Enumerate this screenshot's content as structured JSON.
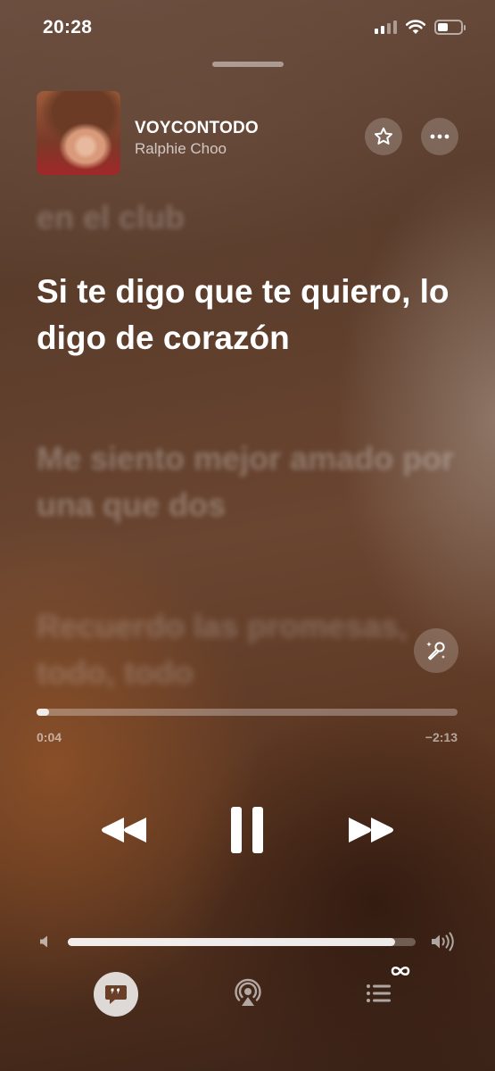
{
  "status_bar": {
    "time": "20:28",
    "icons": [
      "cellular-signal-icon",
      "wifi-icon",
      "battery-icon"
    ]
  },
  "now_playing": {
    "title": "VOYCONTODO",
    "artist": "Ralphie Choo",
    "favorite_icon": "star-icon",
    "more_icon": "ellipsis-icon"
  },
  "lyrics": {
    "past_line": "en el club",
    "current_line": "Si te digo que te quiero, lo digo de corazón",
    "next_line": "Me siento mejor amado por una que dos",
    "following_line": "Recuerdo las promesas, todo, todo"
  },
  "playback": {
    "elapsed": "0:04",
    "remaining": "−2:13",
    "progress": 0.03,
    "controls": [
      "rewind-icon",
      "pause-icon",
      "fast-forward-icon"
    ]
  },
  "volume": {
    "level": 0.94
  },
  "bottom_bar": {
    "buttons": [
      "lyrics-icon",
      "airplay-icon",
      "queue-icon"
    ],
    "queue_badge_icon": "infinity-icon"
  },
  "colors": {
    "accent_text": "#ffffff",
    "background_base": "#5a3c2b"
  }
}
